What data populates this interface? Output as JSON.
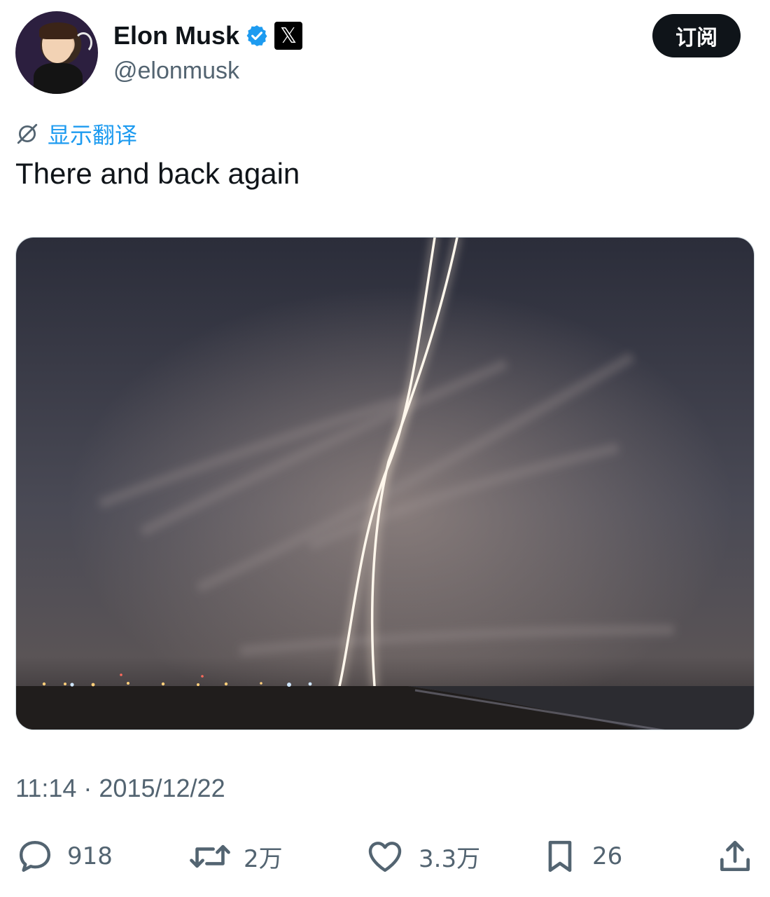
{
  "author": {
    "name": "Elon Musk",
    "handle": "@elonmusk",
    "x_badge": "𝕏"
  },
  "subscribe_label": "订阅",
  "translate_label": "显示翻译",
  "tweet_text": "There and back again",
  "timestamp": "11:14 · 2015/12/22",
  "stats": {
    "replies": "918",
    "retweets": "2万",
    "likes": "3.3万",
    "bookmarks": "26"
  },
  "icons": [
    "verified-icon",
    "x-logo-icon",
    "translate-icon",
    "reply-icon",
    "retweet-icon",
    "like-icon",
    "bookmark-icon",
    "share-icon"
  ],
  "colors": {
    "accent": "#1d9bf0",
    "text": "#0f1419",
    "muted": "#536471"
  }
}
